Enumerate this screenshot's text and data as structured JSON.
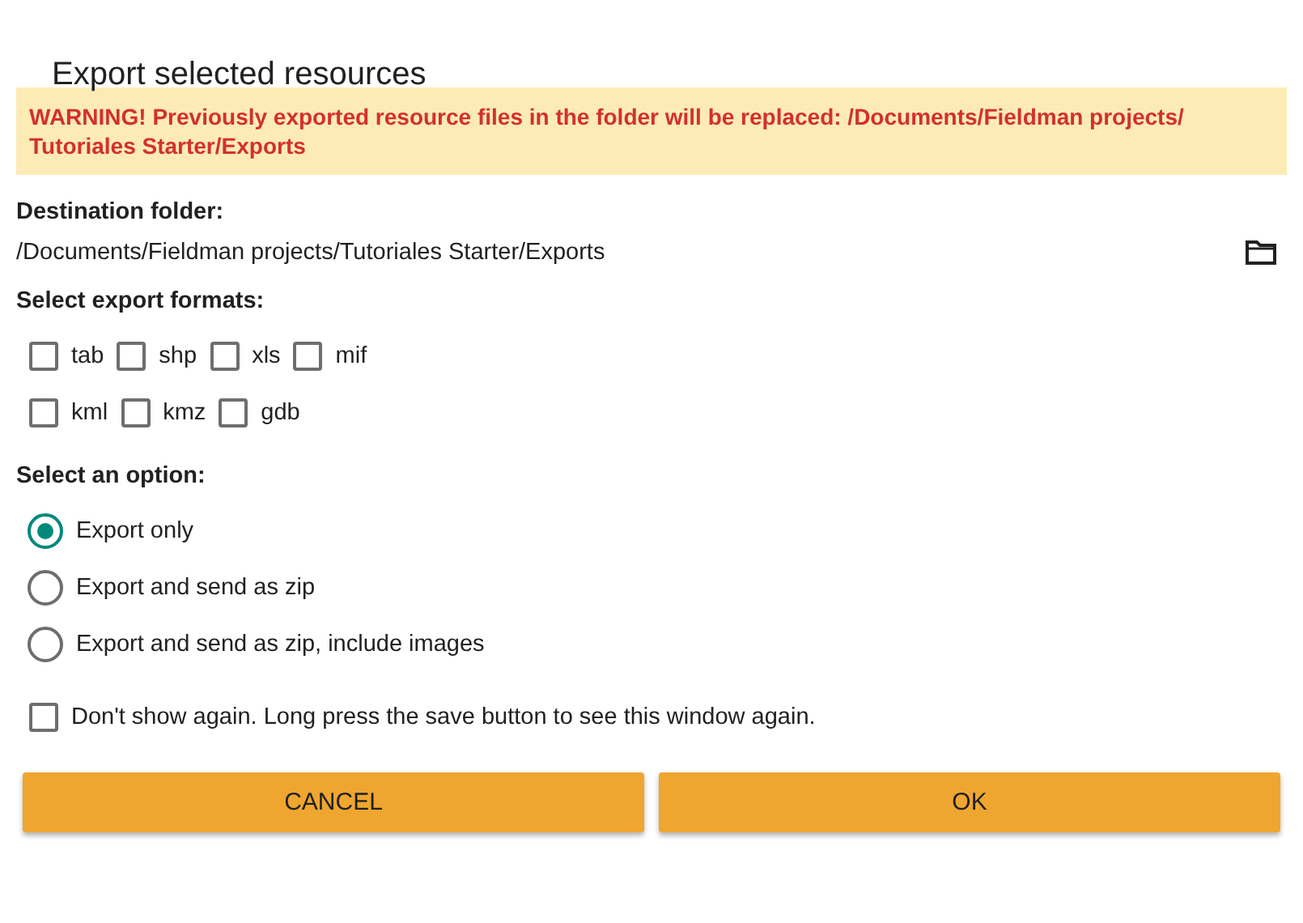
{
  "dialog": {
    "title": "Export selected resources"
  },
  "warning": "WARNING! Previously exported resource files in the folder will be replaced: /Documents/Fieldman projects/ Tutoriales Starter/Exports",
  "destination": {
    "label": "Destination folder:",
    "path": "/Documents/Fieldman projects/Tutoriales Starter/Exports"
  },
  "formats": {
    "label": "Select export formats:",
    "rows": [
      [
        {
          "label": "tab",
          "checked": false
        },
        {
          "label": "shp",
          "checked": false
        },
        {
          "label": "xls",
          "checked": false
        },
        {
          "label": "mif",
          "checked": false
        }
      ],
      [
        {
          "label": "kml",
          "checked": false
        },
        {
          "label": "kmz",
          "checked": false
        },
        {
          "label": "gdb",
          "checked": false
        }
      ]
    ]
  },
  "options": {
    "label": "Select an option:",
    "items": [
      {
        "label": "Export only",
        "selected": true
      },
      {
        "label": "Export and send as zip",
        "selected": false
      },
      {
        "label": "Export and send as zip, include images",
        "selected": false
      }
    ]
  },
  "dont_show": {
    "label": "Don't show again. Long press the save button to see this window again.",
    "checked": false
  },
  "buttons": [
    "CANCEL",
    "OK"
  ]
}
